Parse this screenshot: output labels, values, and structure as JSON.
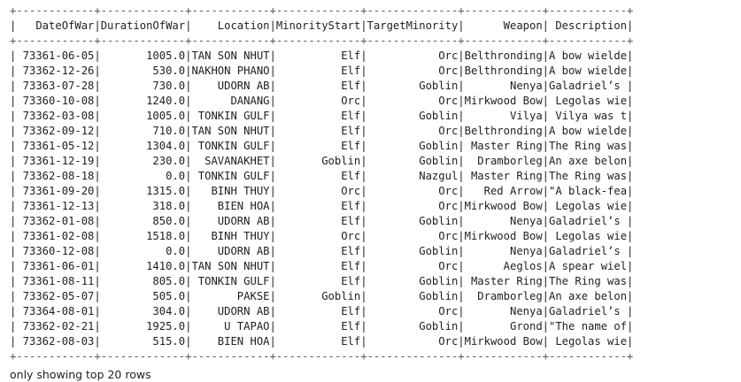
{
  "table": {
    "columns": [
      "DateOfWar",
      "DurationOfWar",
      "Location",
      "MinorityStart",
      "TargetMinority",
      "Weapon",
      "Description"
    ],
    "widths": [
      12,
      13,
      12,
      13,
      14,
      12,
      12
    ],
    "rows": [
      [
        "73361-06-05",
        "1005.0",
        "TAN SON NHUT",
        "Elf",
        "Orc",
        "Belthronding",
        "A bow wielded by ..."
      ],
      [
        "73362-12-26",
        "530.0",
        "NAKHON PHANOM",
        "Elf",
        "Orc",
        "Belthronding",
        "A bow wielded by ..."
      ],
      [
        "73363-07-28",
        "730.0",
        "UDORN AB",
        "Elf",
        "Goblin",
        "Nenya",
        "Galadriel’s ring ..."
      ],
      [
        "73360-10-08",
        "1240.0",
        "DANANG",
        "Orc",
        "Orc",
        "Mirkwood Bow",
        " Legolas wielded ..."
      ],
      [
        "73362-03-08",
        "1005.0",
        "TONKIN GULF",
        "Elf",
        "Goblin",
        "Vilya",
        " Vilya was the st..."
      ],
      [
        "73362-09-12",
        "710.0",
        "TAN SON NHUT",
        "Elf",
        "Orc",
        "Belthronding",
        "A bow wielded by ..."
      ],
      [
        "73361-05-12",
        "1304.0",
        "TONKIN GULF",
        "Elf",
        "Goblin",
        "Master Ring",
        "The Ring was a si..."
      ],
      [
        "73361-12-19",
        "230.0",
        "SAVANAKHET",
        "Goblin",
        "Goblin",
        "Dramborleg",
        "An axe belonging ..."
      ],
      [
        "73362-08-18",
        "0.0",
        "TONKIN GULF",
        "Elf",
        "Nazgul",
        "Master Ring",
        "The Ring was a si..."
      ],
      [
        "73361-09-20",
        "1315.0",
        "BINH THUY",
        "Orc",
        "Orc",
        "Red Arrow",
        "\"A black-feathere..."
      ],
      [
        "73361-12-13",
        "318.0",
        "BIEN HOA",
        "Elf",
        "Orc",
        "Mirkwood Bow",
        " Legolas wielded ..."
      ],
      [
        "73362-01-08",
        "850.0",
        "UDORN AB",
        "Elf",
        "Goblin",
        "Nenya",
        "Galadriel’s ring ..."
      ],
      [
        "73361-02-08",
        "1518.0",
        "BINH THUY",
        "Orc",
        "Orc",
        "Mirkwood Bow",
        " Legolas wielded ..."
      ],
      [
        "73360-12-08",
        "0.0",
        "UDORN AB",
        "Elf",
        "Goblin",
        "Nenya",
        "Galadriel’s ring ..."
      ],
      [
        "73361-06-01",
        "1410.0",
        "TAN SON NHUT",
        "Elf",
        "Orc",
        "Aeglos",
        "A spear wielded b..."
      ],
      [
        "73361-08-11",
        "805.0",
        "TONKIN GULF",
        "Elf",
        "Goblin",
        "Master Ring",
        "The Ring was a si..."
      ],
      [
        "73362-05-07",
        "505.0",
        "PAKSE",
        "Goblin",
        "Goblin",
        "Dramborleg",
        "An axe belonging ..."
      ],
      [
        "73364-08-01",
        "304.0",
        "UDORN AB",
        "Elf",
        "Orc",
        "Nenya",
        "Galadriel’s ring ..."
      ],
      [
        "73362-02-21",
        "1925.0",
        "U TAPAO",
        "Elf",
        "Goblin",
        "Grond",
        "\"The name of the ..."
      ],
      [
        "73362-08-03",
        "515.0",
        "BIEN HOA",
        "Elf",
        "Orc",
        "Mirkwood Bow",
        " Legolas wielded ..."
      ]
    ]
  },
  "footer": "only showing top 20 rows"
}
